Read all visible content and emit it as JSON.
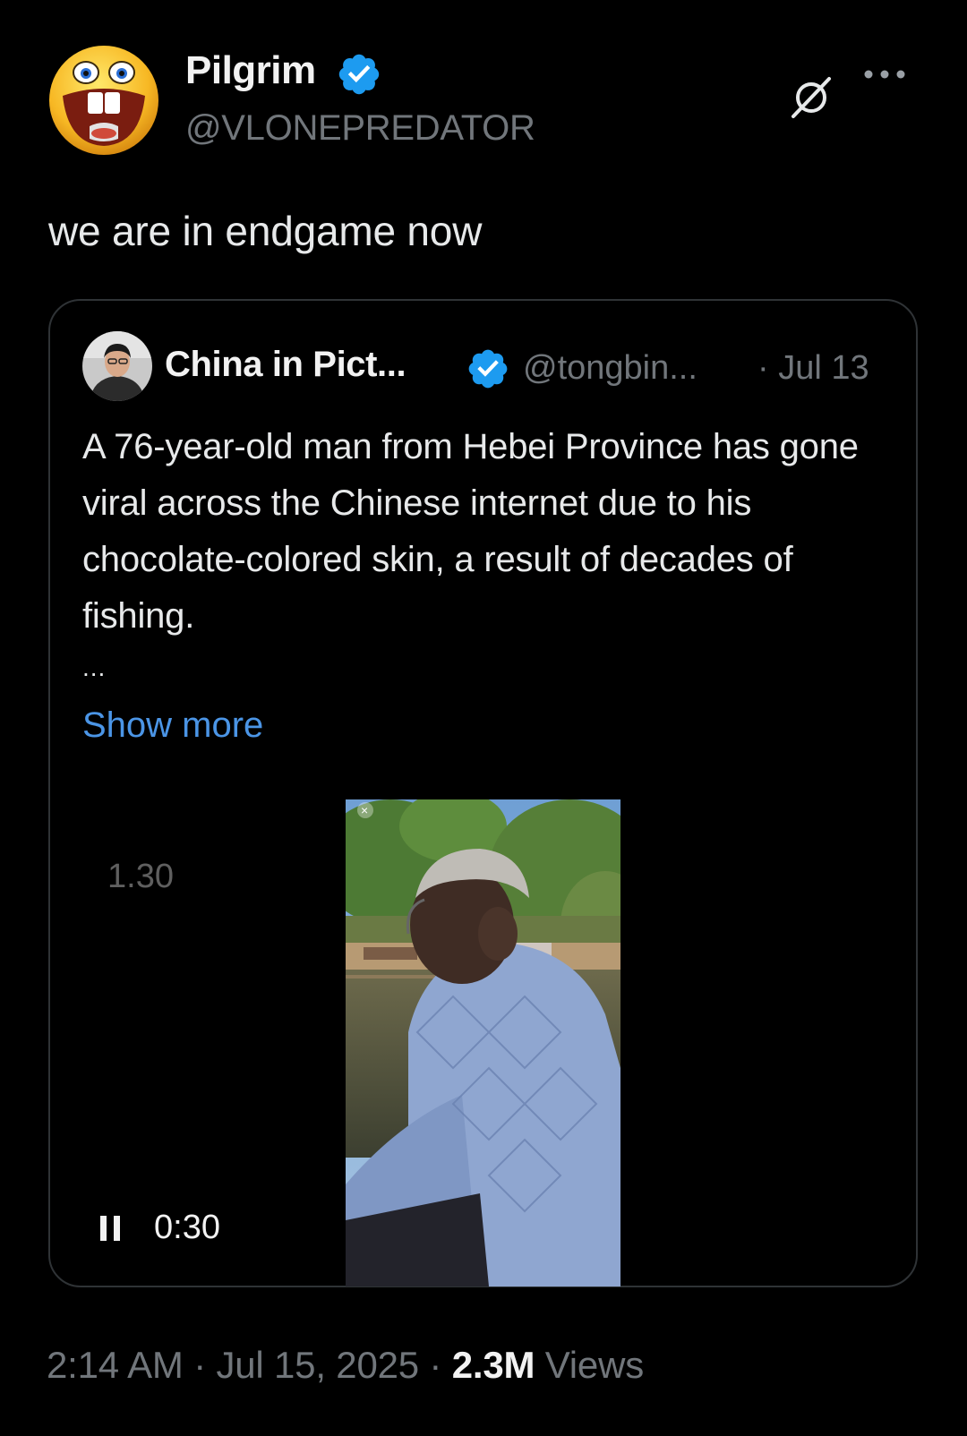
{
  "author": {
    "display_name": "Pilgrim",
    "handle": "@VLONEPREDATOR"
  },
  "tweet": {
    "text": "we are in endgame now"
  },
  "quoted": {
    "display_name": "China in Pict...",
    "handle": "@tongbin...",
    "date": "· Jul 13",
    "text": "A 76-year-old man from Hebei Province has gone viral across the Chinese internet due to his chocolate-colored skin, a result of decades of fishing.",
    "ellipsis": "...",
    "show_more": "Show more",
    "video": {
      "speed": "1.30",
      "time": "0:30"
    }
  },
  "footer": {
    "time": "2:14 AM",
    "date": "Jul 15, 2025",
    "separator": "·",
    "views_count": "2.3M",
    "views_label": "Views"
  },
  "colors": {
    "background": "#000000",
    "link": "#4b95e6",
    "verified": "#1d9bf0",
    "muted": "#71767b"
  }
}
